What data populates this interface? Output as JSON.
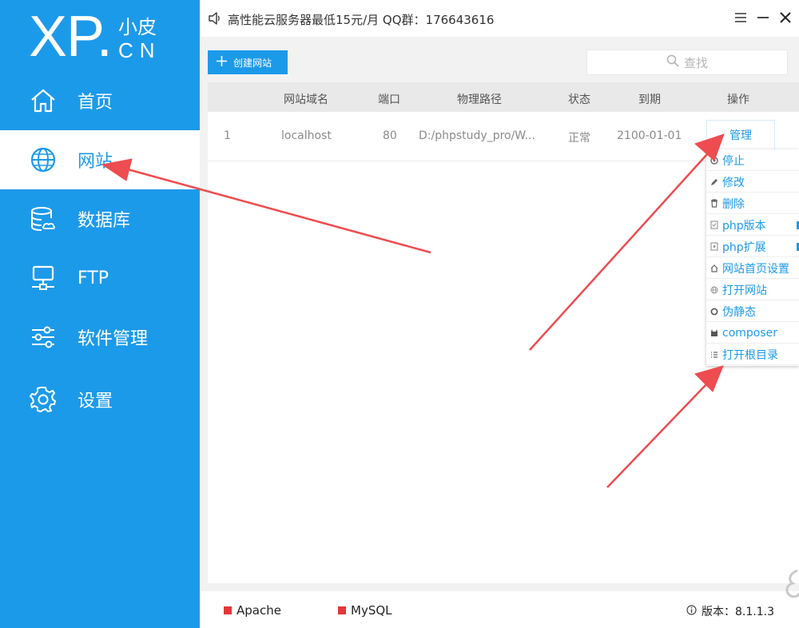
{
  "app": {
    "logo_main": "XP.",
    "logo_top": "小皮",
    "logo_bottom": "CN",
    "title": "高性能云服务器最低15元/月  QQ群：176643616"
  },
  "sidebar": {
    "items": [
      {
        "label": "首页",
        "icon": "home-icon",
        "active": false
      },
      {
        "label": "网站",
        "icon": "globe-icon",
        "active": true
      },
      {
        "label": "数据库",
        "icon": "database-icon",
        "active": false
      },
      {
        "label": "FTP",
        "icon": "ftp-server-icon",
        "active": false
      },
      {
        "label": "软件管理",
        "icon": "sliders-icon",
        "active": false
      },
      {
        "label": "设置",
        "icon": "gear-icon",
        "active": false
      }
    ]
  },
  "toolbar": {
    "create_label": "创建网站",
    "search_placeholder": "查找"
  },
  "table": {
    "headers": [
      "网站域名",
      "端口",
      "物理路径",
      "状态",
      "到期",
      "操作"
    ],
    "rows": [
      {
        "index": "1",
        "domain": "localhost",
        "port": "80",
        "path": "D:/phpstudy_pro/W...",
        "status": "正常",
        "expire": "2100-01-01",
        "action": "管理"
      }
    ]
  },
  "menu": {
    "items": [
      {
        "label": "停止",
        "icon": "stop-icon",
        "submenu": false
      },
      {
        "label": "修改",
        "icon": "pencil-icon",
        "submenu": false
      },
      {
        "label": "删除",
        "icon": "trash-icon",
        "submenu": false
      },
      {
        "label": "php版本",
        "icon": "php-version-icon",
        "submenu": true
      },
      {
        "label": "php扩展",
        "icon": "php-extension-icon",
        "submenu": true
      },
      {
        "label": "网站首页设置",
        "icon": "home-small-icon",
        "submenu": false
      },
      {
        "label": "打开网站",
        "icon": "globe-small-icon",
        "submenu": false
      },
      {
        "label": "伪静态",
        "icon": "circle-icon",
        "submenu": false
      },
      {
        "label": "composer",
        "icon": "composer-icon",
        "submenu": false
      },
      {
        "label": "打开根目录",
        "icon": "list-icon",
        "submenu": false
      }
    ]
  },
  "footer": {
    "services": [
      {
        "name": "Apache",
        "color": "#e5363a"
      },
      {
        "name": "MySQL",
        "color": "#e5363a"
      }
    ],
    "version_label": "版本：8.1.1.3"
  },
  "colors": {
    "accent": "#1c9aea",
    "annotation_arrow": "#ee4c50",
    "service_stopped": "#e5363a"
  }
}
